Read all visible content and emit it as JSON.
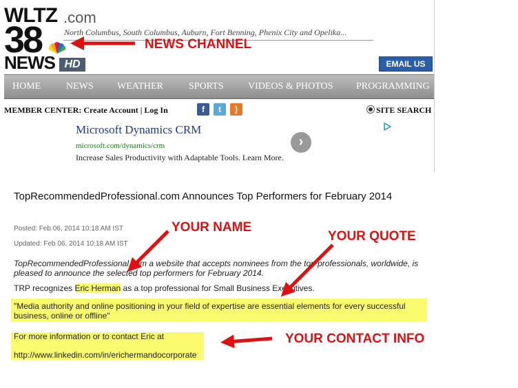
{
  "header": {
    "logo_call": "WLTZ",
    "logo_dotcom": ".com",
    "logo_number": "38",
    "logo_news": "NEWS",
    "logo_hd": "HD",
    "region": "North Columbus, South Columbus, Auburn, Fort Benning, Phenix City and Opelika...",
    "email_button": "EMAIL US"
  },
  "nav": {
    "items": [
      {
        "label": "HOME"
      },
      {
        "label": "NEWS"
      },
      {
        "label": "WEATHER"
      },
      {
        "label": "SPORTS"
      },
      {
        "label": "VIDEOS & PHOTOS"
      },
      {
        "label": "PROGRAMMING"
      }
    ]
  },
  "member_bar": {
    "label": "MEMBER CENTER: Create Account  | Log In",
    "social_icons": [
      "facebook-icon",
      "twitter-icon",
      "rss-icon"
    ],
    "site_search": "SITE SEARCH"
  },
  "ad": {
    "title": "Microsoft Dynamics CRM",
    "url": "microsoft.com/dynamics/crm",
    "description": "Increase Sales Productivity with Adaptable Tools. Learn More."
  },
  "article": {
    "headline": "TopRecommendedProfessional.com Announces Top Performers for February 2014",
    "posted": "Posted: Feb 06, 2014 10:18 AM IST",
    "updated": "Updated: Feb 06, 2014 10:18 AM IST",
    "intro": "TopRecommendedProfessional.com a website that accepts nominees from the top professionals, worldwide, is pleased to announce the selected top performers for February 2014.",
    "recognizes_prefix": "TRP recognizes",
    "name": "Eric Herman",
    "recognizes_suffix": "as a top professional for Small Business Executives.",
    "quote": "\"Media authority and online positioning in your field of expertise are essential elements for every successful business, online or offline\"",
    "contact_line": "For more information or to contact Eric at",
    "contact_url": "http://www.linkedin.com/in/erichermandocorporate"
  },
  "callouts": {
    "news_channel": "NEWS CHANNEL",
    "your_name": "YOUR NAME",
    "your_quote": "YOUR QUOTE",
    "your_contact": "YOUR CONTACT INFO",
    "color": "#e01010"
  },
  "colors": {
    "highlight": "#fafa6e",
    "nav_bg": "#a3a3a3",
    "email_button": "#2a5ea8"
  }
}
